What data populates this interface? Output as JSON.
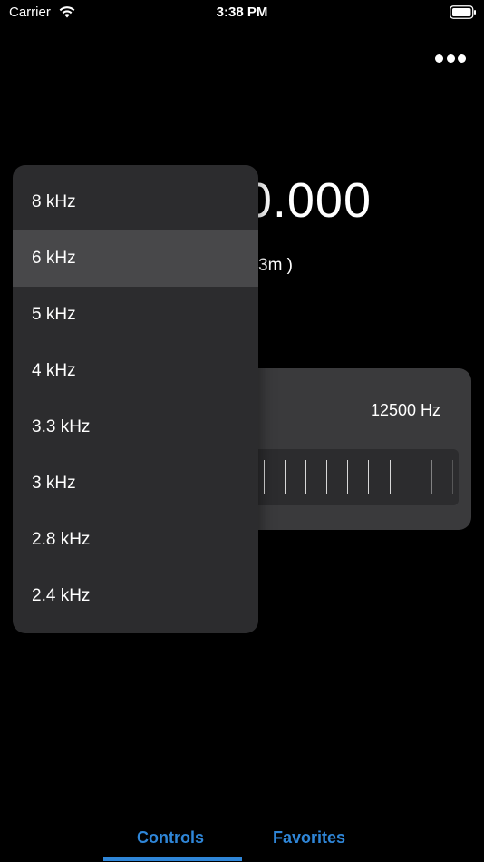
{
  "status_bar": {
    "carrier": "Carrier",
    "time": "3:38 PM"
  },
  "display": {
    "frequency": "0.000",
    "wavelength": "3m )"
  },
  "bandwidth": {
    "value": "12500 Hz"
  },
  "dropdown": {
    "selected_index": 1,
    "items": [
      {
        "label": "8 kHz"
      },
      {
        "label": "6 kHz"
      },
      {
        "label": "5 kHz"
      },
      {
        "label": "4 kHz"
      },
      {
        "label": "3.3 kHz"
      },
      {
        "label": "3 kHz"
      },
      {
        "label": "2.8 kHz"
      },
      {
        "label": "2.4 kHz"
      }
    ]
  },
  "tabs": [
    {
      "label": "Controls",
      "active": true
    },
    {
      "label": "Favorites",
      "active": false
    }
  ],
  "colors": {
    "accent": "#2f86d8",
    "background": "#000000",
    "menu": "#2c2c2e",
    "menu_selected": "#48484a",
    "card": "#3a3a3c"
  },
  "icons": [
    "wifi-icon",
    "battery-icon",
    "more-icon"
  ]
}
